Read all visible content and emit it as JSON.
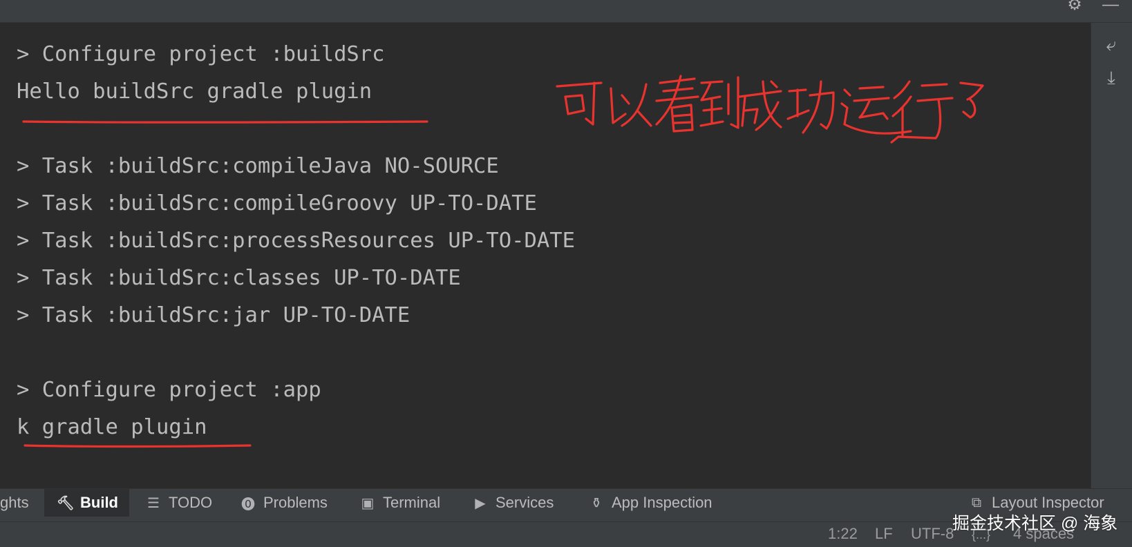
{
  "top_bar": {
    "settings_icon": "gear-icon",
    "hide_icon": "minimize-icon"
  },
  "console": {
    "lines": [
      "> Configure project :buildSrc",
      "Hello buildSrc gradle plugin",
      "",
      "> Task :buildSrc:compileJava NO-SOURCE",
      "> Task :buildSrc:compileGroovy UP-TO-DATE",
      "> Task :buildSrc:processResources UP-TO-DATE",
      "> Task :buildSrc:classes UP-TO-DATE",
      "> Task :buildSrc:jar UP-TO-DATE",
      "",
      "> Configure project :app",
      "k gradle plugin"
    ],
    "text_color": "#bbbbbb",
    "background": "#2b2b2b"
  },
  "annotation": {
    "handwritten_note": "可以看到成功运行了",
    "ink_color": "#e8332e"
  },
  "right_strip": {
    "icons": [
      "soft-wrap-icon",
      "scroll-to-end-icon"
    ]
  },
  "tool_tabs": [
    {
      "label": "ghts",
      "icon": "",
      "active": false
    },
    {
      "label": "Build",
      "icon": "hammer-icon",
      "active": true
    },
    {
      "label": "TODO",
      "icon": "list-icon",
      "active": false
    },
    {
      "label": "Problems",
      "icon": "problems-icon",
      "active": false
    },
    {
      "label": "Terminal",
      "icon": "terminal-icon",
      "active": false
    },
    {
      "label": "Services",
      "icon": "services-icon",
      "active": false
    },
    {
      "label": "App Inspection",
      "icon": "app-inspection-icon",
      "active": false
    },
    {
      "label": "Layout Inspector",
      "icon": "layout-inspector-icon",
      "active": false
    }
  ],
  "status_bar": {
    "position": "1:22",
    "line_separator": "LF",
    "encoding": "UTF-8",
    "context": "{...}",
    "indent": "4 spaces"
  },
  "watermark": "掘金技术社区 @ 海象"
}
